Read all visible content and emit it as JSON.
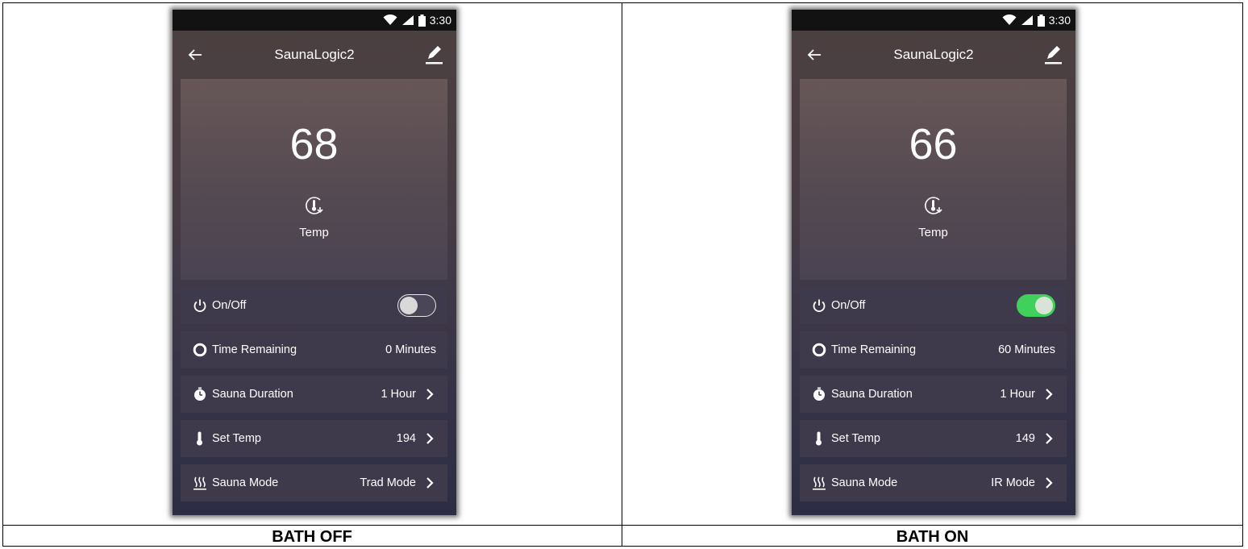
{
  "panels": [
    {
      "caption": "BATH OFF",
      "status_time": "3:30",
      "title": "SaunaLogic2",
      "temp": "68",
      "temp_label": "Temp",
      "onoff_label": "On/Off",
      "power_on": false,
      "time_remaining_label": "Time Remaining",
      "time_remaining_value": "0 Minutes",
      "duration_label": "Sauna Duration",
      "duration_value": "1 Hour",
      "set_temp_label": "Set Temp",
      "set_temp_value": "194",
      "mode_label": "Sauna Mode",
      "mode_value": "Trad Mode"
    },
    {
      "caption": "BATH ON",
      "status_time": "3:30",
      "title": "SaunaLogic2",
      "temp": "66",
      "temp_label": "Temp",
      "onoff_label": "On/Off",
      "power_on": true,
      "time_remaining_label": "Time Remaining",
      "time_remaining_value": "60 Minutes",
      "duration_label": "Sauna Duration",
      "duration_value": "1 Hour",
      "set_temp_label": "Set Temp",
      "set_temp_value": "149",
      "mode_label": "Sauna Mode",
      "mode_value": "IR Mode"
    }
  ],
  "icons": {
    "back": "arrow-left-icon",
    "edit": "pencil-icon",
    "temp": "thermometer-cycle-icon",
    "power": "power-icon",
    "time": "circle-icon",
    "duration": "stopwatch-icon",
    "set_temp": "thermometer-icon",
    "mode": "heat-waves-icon",
    "chevron": "chevron-right-icon"
  },
  "colors": {
    "toggle_on": "#3fd15c",
    "row_bg": "#3e3a4c",
    "status_bar": "#121212"
  }
}
